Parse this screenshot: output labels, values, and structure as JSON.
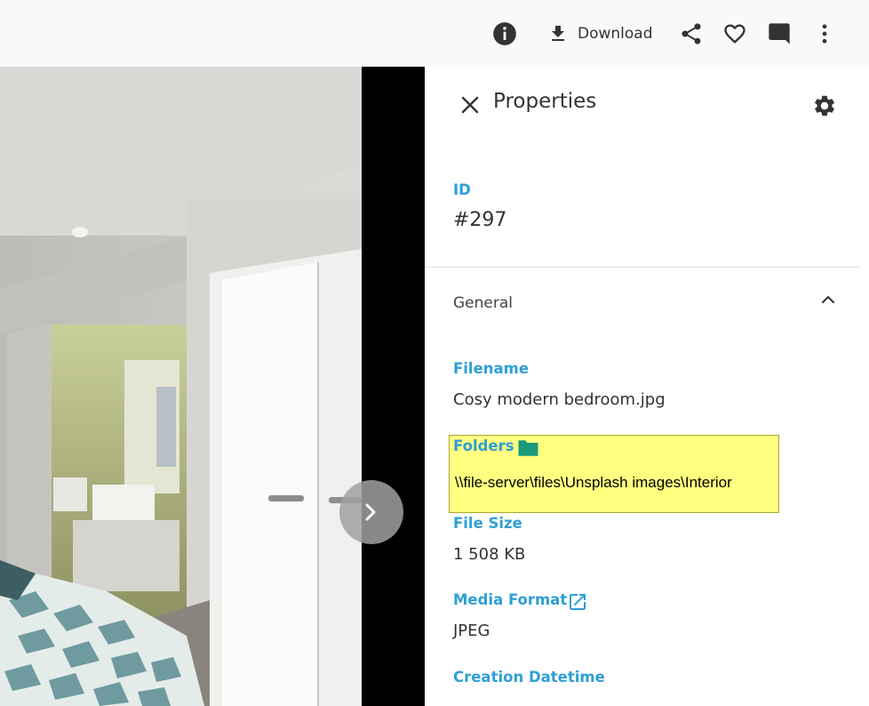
{
  "toolbar": {
    "info_icon": "info-icon",
    "download_label": "Download",
    "share_icon": "share-icon",
    "favorite_icon": "heart-icon",
    "comment_icon": "comment-icon",
    "more_icon": "more-vert-icon"
  },
  "viewer": {
    "next_icon": "chevron-right-icon"
  },
  "panel": {
    "title": "Properties",
    "id_label": "ID",
    "id_value": "#297",
    "section_title": "General",
    "filename_label": "Filename",
    "filename_value": "Cosy modern bedroom.jpg",
    "folders_label": "Folders",
    "folders_value": "\\\\file-server\\files\\Unsplash images\\Interior",
    "filesize_label": "File Size",
    "filesize_value": "1 508 KB",
    "mediaformat_label": "Media Format",
    "mediaformat_value": "JPEG",
    "creation_label": "Creation Datetime"
  },
  "colors": {
    "accent": "#2e9fd4",
    "folder_icon": "#1a9a7a",
    "highlight": "#ffff80"
  }
}
